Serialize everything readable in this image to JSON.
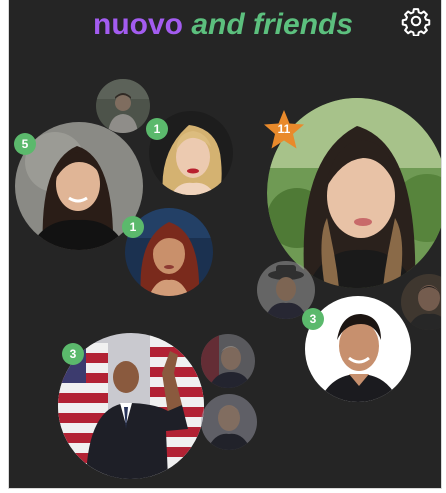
{
  "header": {
    "title_part1": "nuovo",
    "title_part2": "and friends",
    "settings_icon": "gear-icon"
  },
  "colors": {
    "title_purple": "#a35cf0",
    "title_green": "#5cc07e",
    "badge_green": "#5bb96c",
    "star_orange": "#e98a2b",
    "background": "#252525"
  },
  "friends": [
    {
      "id": "small-top-left",
      "badge": ""
    },
    {
      "id": "blonde-woman",
      "badge": "1"
    },
    {
      "id": "dark-hair-woman",
      "badge": "5"
    },
    {
      "id": "red-hair-woman",
      "badge": "1"
    },
    {
      "id": "featured-woman",
      "badge": "11",
      "badge_style": "star"
    },
    {
      "id": "hat-man",
      "badge": ""
    },
    {
      "id": "right-edge-man",
      "badge": ""
    },
    {
      "id": "smiling-man",
      "badge": "3"
    },
    {
      "id": "waving-man",
      "badge": "3"
    },
    {
      "id": "small-bottom-right-1",
      "badge": ""
    },
    {
      "id": "small-bottom-right-2",
      "badge": ""
    }
  ]
}
